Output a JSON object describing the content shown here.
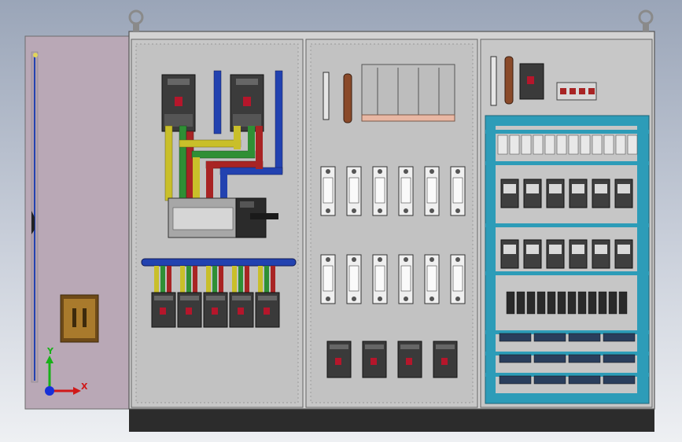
{
  "viewport": {
    "name": "cad-graphics-area"
  },
  "triad": {
    "x_label": "X",
    "y_label": "Y",
    "x_color": "#d01818",
    "y_color": "#18b018",
    "z_color": "#1830d8"
  },
  "colors": {
    "panel_fill": "#c6c6c6",
    "panel_edge": "#6b6b6b",
    "door_fill": "#b8a6b4",
    "plinth": "#2c2c2c",
    "rail_teal": "#2d9cb8",
    "busbar_yellow": "#c9bf2a",
    "busbar_green": "#2f8f35",
    "busbar_red": "#a82424",
    "busbar_blue": "#2242b0",
    "copper": "#8a4a2a",
    "breaker_dark": "#3a3a3a"
  },
  "cabinet": {
    "sections": [
      "left-power-section",
      "middle-switch-section",
      "right-control-section"
    ],
    "left": {
      "top_breakers": 2,
      "bottom_breakers": 5
    },
    "middle": {
      "fuse_rows": 2,
      "fuses_per_row": 6,
      "bottom_breakers": 4
    },
    "right": {
      "relay_rows": 2,
      "relays_per_row": 6,
      "din_rails": 6
    }
  }
}
